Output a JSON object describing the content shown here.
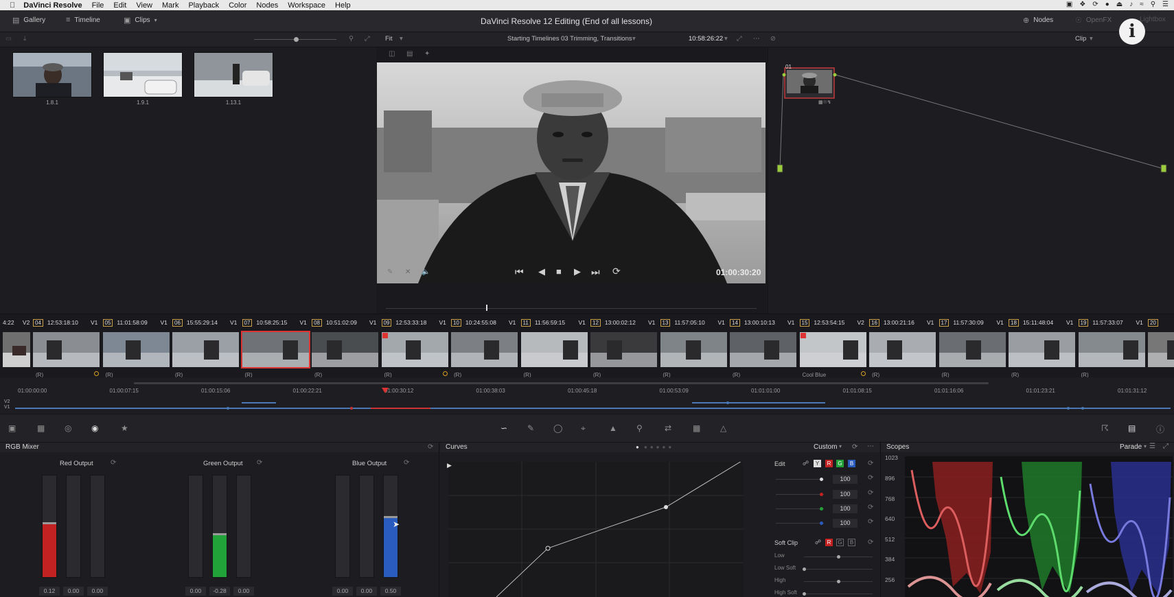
{
  "menubar": {
    "app": "DaVinci Resolve",
    "items": [
      "File",
      "Edit",
      "View",
      "Mark",
      "Playback",
      "Color",
      "Nodes",
      "Workspace",
      "Help"
    ]
  },
  "topbar": {
    "gallery": "Gallery",
    "timeline": "Timeline",
    "clips": "Clips",
    "project_title": "DaVinci Resolve 12 Editing (End of all lessons)",
    "nodes": "Nodes",
    "openfx": "OpenFX",
    "lightbox": "Lightbox"
  },
  "subbar": {
    "zoom_mode": "Fit",
    "timeline_name": "Starting Timelines 03 Trimming, Transitions",
    "timecode": "10:58:26:22",
    "node_mode": "Clip"
  },
  "gallery": {
    "stills": [
      {
        "label": "1.8.1"
      },
      {
        "label": "1.9.1"
      },
      {
        "label": "1.13.1"
      }
    ]
  },
  "viewer": {
    "timecode": "01:00:30:20"
  },
  "nodes": {
    "node_label": "01"
  },
  "clips": {
    "lead_tc": "4:22",
    "lead_track": "V2",
    "items": [
      {
        "num": "04",
        "tc": "12:53:18:10",
        "track": "V1",
        "foot": "(R)"
      },
      {
        "num": "05",
        "tc": "11:01:58:09",
        "track": "V1",
        "foot": "(R)"
      },
      {
        "num": "06",
        "tc": "15:55:29:14",
        "track": "V1",
        "foot": "(R)"
      },
      {
        "num": "07",
        "tc": "10:58:25:15",
        "track": "V1",
        "foot": "(R)"
      },
      {
        "num": "08",
        "tc": "10:51:02:09",
        "track": "V1",
        "foot": "(R)"
      },
      {
        "num": "09",
        "tc": "12:53:33:18",
        "track": "V1",
        "foot": "(R)"
      },
      {
        "num": "10",
        "tc": "10:24:55:08",
        "track": "V1",
        "foot": "(R)"
      },
      {
        "num": "11",
        "tc": "11:56:59:15",
        "track": "V1",
        "foot": "(R)"
      },
      {
        "num": "12",
        "tc": "13:00:02:12",
        "track": "V1",
        "foot": "(R)"
      },
      {
        "num": "13",
        "tc": "11:57:05:10",
        "track": "V1",
        "foot": "(R)"
      },
      {
        "num": "14",
        "tc": "13:00:10:13",
        "track": "V1",
        "foot": "(R)"
      },
      {
        "num": "15",
        "tc": "12:53:54:15",
        "track": "V2",
        "foot": "Cool Blue"
      },
      {
        "num": "16",
        "tc": "13:00:21:16",
        "track": "V1",
        "foot": "(R)"
      },
      {
        "num": "17",
        "tc": "11:57:30:09",
        "track": "V1",
        "foot": "(R)"
      },
      {
        "num": "18",
        "tc": "15:11:48:04",
        "track": "V1",
        "foot": "(R)"
      },
      {
        "num": "19",
        "tc": "11:57:33:07",
        "track": "V1",
        "foot": "(R)"
      },
      {
        "num": "20",
        "tc": "",
        "track": "",
        "foot": ""
      }
    ]
  },
  "minitimeline": {
    "timecodes": [
      "01:00:00:00",
      "01:00:07:15",
      "01:00:15:06",
      "01:00:22:21",
      "01:00:30:12",
      "01:00:38:03",
      "01:00:45:18",
      "01:00:53:09",
      "01:01:01:00",
      "01:01:08:15",
      "01:01:16:06",
      "01:01:23:21",
      "01:01:31:12"
    ],
    "track_v2": "V2",
    "track_v1": "V1"
  },
  "rgbmixer": {
    "title": "RGB Mixer",
    "red_output": "Red Output",
    "green_output": "Green Output",
    "blue_output": "Blue Output",
    "values": {
      "red": [
        "0.12",
        "0.00",
        "0.00"
      ],
      "green": [
        "0.00",
        "-0.28",
        "0.00"
      ],
      "blue": [
        "0.00",
        "0.00",
        "0.50"
      ]
    }
  },
  "curves": {
    "title": "Curves",
    "mode": "Custom",
    "edit_label": "Edit",
    "y_label": "Y",
    "r_label": "R",
    "g_label": "G",
    "b_label": "B",
    "edit_values": [
      "100",
      "100",
      "100",
      "100"
    ],
    "soft_clip": "Soft Clip",
    "low": "Low",
    "low_soft": "Low Soft",
    "high": "High",
    "high_soft": "High Soft"
  },
  "scopes": {
    "title": "Scopes",
    "mode": "Parade",
    "scale": [
      "1023",
      "896",
      "768",
      "640",
      "512",
      "384",
      "256"
    ]
  },
  "colors": {
    "accent_red": "#c32222",
    "accent_green": "#22a33a",
    "accent_blue": "#2a5bbf",
    "node_green": "#9ccb3d"
  }
}
